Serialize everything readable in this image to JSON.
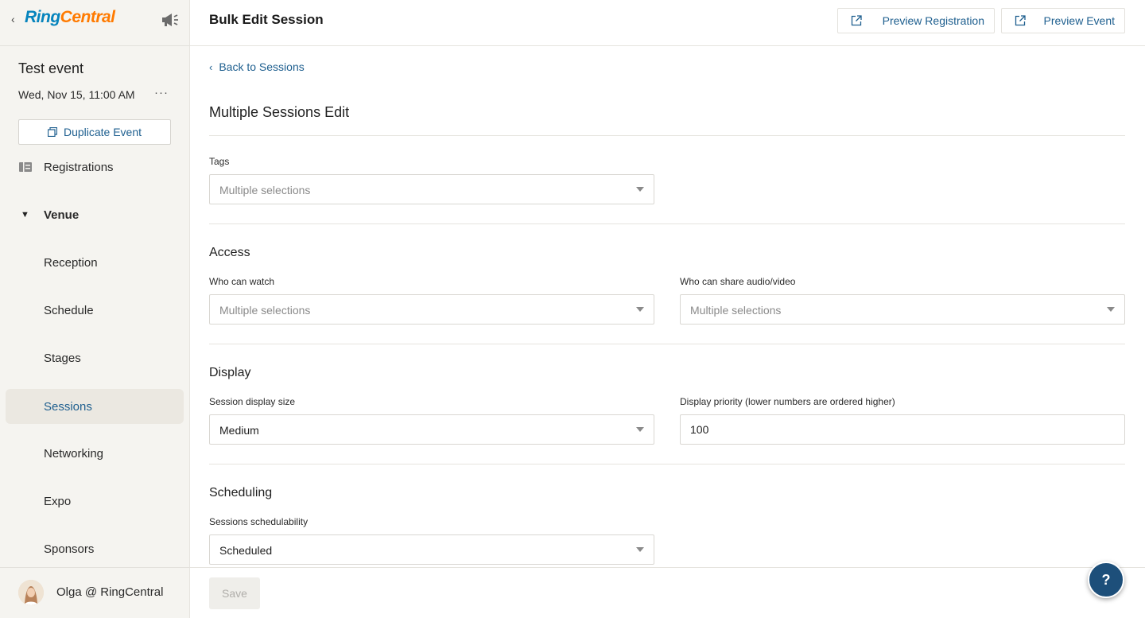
{
  "sidebar": {
    "logo": {
      "ring": "Ring",
      "central": "Central"
    },
    "event_name": "Test event",
    "event_date": "Wed, Nov 15, 11:00 AM",
    "more": "···",
    "duplicate_label": "Duplicate Event",
    "registrations_label": "Registrations",
    "venue_label": "Venue",
    "items": [
      {
        "label": "Reception"
      },
      {
        "label": "Schedule"
      },
      {
        "label": "Stages"
      },
      {
        "label": "Sessions",
        "active": true
      },
      {
        "label": "Networking"
      },
      {
        "label": "Expo"
      },
      {
        "label": "Sponsors"
      }
    ],
    "user_name": "Olga @ RingCentral"
  },
  "header": {
    "title": "Bulk Edit Session",
    "preview_registration": "Preview Registration",
    "preview_event": "Preview Event"
  },
  "main": {
    "back_label": "Back to Sessions",
    "section_title": "Multiple Sessions Edit",
    "tags": {
      "label": "Tags",
      "placeholder": "Multiple selections"
    },
    "access": {
      "title": "Access",
      "who_can_watch": {
        "label": "Who can watch",
        "placeholder": "Multiple selections"
      },
      "who_can_share": {
        "label": "Who can share audio/video",
        "placeholder": "Multiple selections"
      }
    },
    "display": {
      "title": "Display",
      "size": {
        "label": "Session display size",
        "value": "Medium"
      },
      "priority": {
        "label": "Display priority (lower numbers are ordered higher)",
        "value": "100"
      }
    },
    "scheduling": {
      "title": "Scheduling",
      "schedulability": {
        "label": "Sessions schedulability",
        "value": "Scheduled"
      }
    }
  },
  "footer": {
    "save_label": "Save"
  },
  "help": {
    "label": "?"
  },
  "colors": {
    "accent": "#1e5f8f",
    "brand_blue": "#0684bd",
    "brand_orange": "#ff7a00",
    "help_bg": "#1d4f7a"
  }
}
